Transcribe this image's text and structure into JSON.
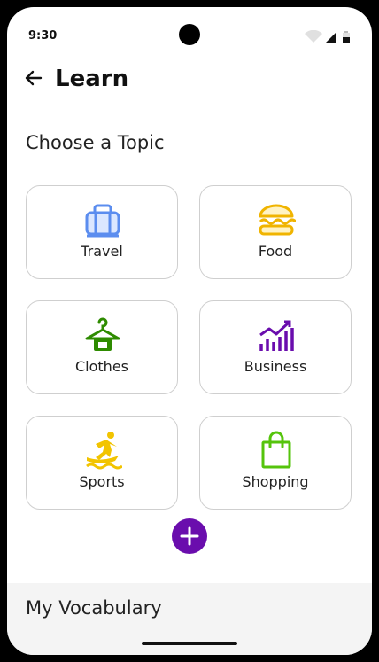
{
  "status": {
    "time": "9:30"
  },
  "header": {
    "title": "Learn"
  },
  "section": {
    "heading": "Choose a Topic"
  },
  "topics": [
    {
      "label": "Travel",
      "icon": "luggage-icon",
      "color": "#5b8def"
    },
    {
      "label": "Food",
      "icon": "burger-icon",
      "color": "#f0b400"
    },
    {
      "label": "Clothes",
      "icon": "hanger-icon",
      "color": "#2e8b00"
    },
    {
      "label": "Business",
      "icon": "chart-icon",
      "color": "#6a0dad"
    },
    {
      "label": "Sports",
      "icon": "surfing-icon",
      "color": "#f2c400"
    },
    {
      "label": "Shopping",
      "icon": "shopping-bag-icon",
      "color": "#55c40c"
    }
  ],
  "fab": {
    "icon": "plus-icon",
    "color": "#6a0dad"
  },
  "bottom": {
    "title": "My Vocabulary"
  }
}
